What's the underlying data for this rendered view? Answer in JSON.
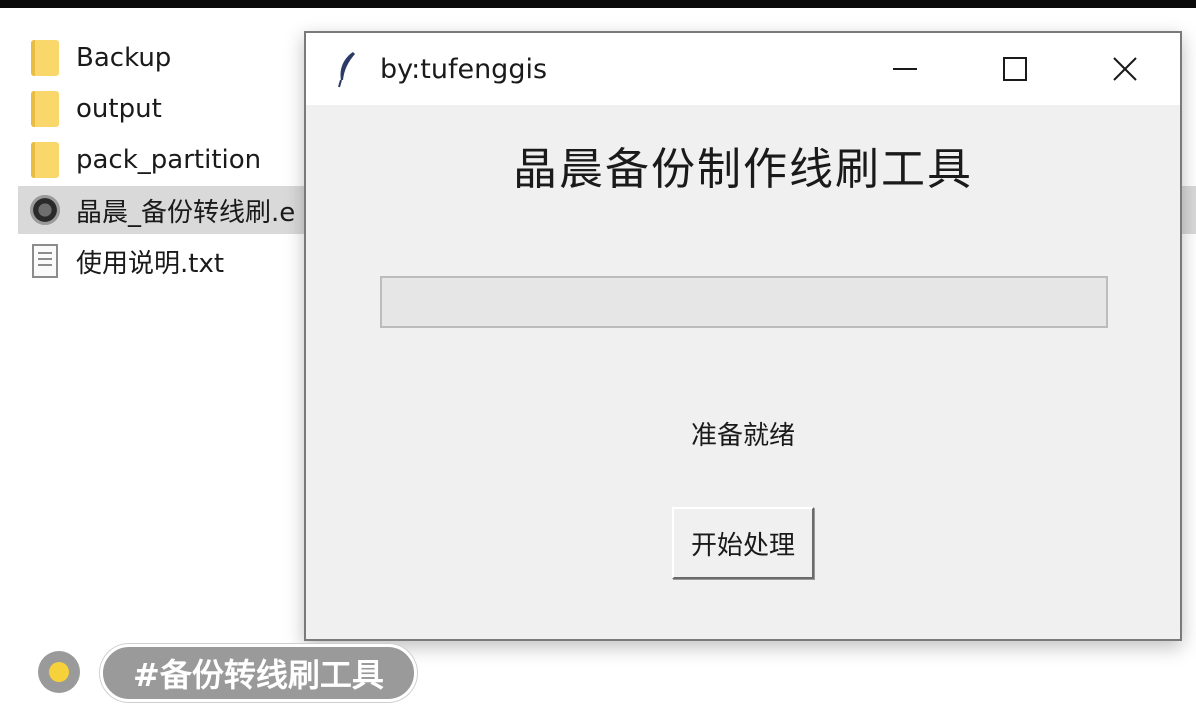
{
  "explorer": {
    "files": [
      {
        "name": "Backup",
        "icon": "folder-icon"
      },
      {
        "name": "output",
        "icon": "folder-icon"
      },
      {
        "name": "pack_partition",
        "icon": "folder-icon"
      },
      {
        "name": "晶晨_备份转线刷.e",
        "icon": "exe-icon",
        "selected": true
      },
      {
        "name": "使用说明.txt",
        "icon": "text-file-icon"
      }
    ]
  },
  "window": {
    "title": "by:tufenggis",
    "icon": "feather-icon",
    "controls": [
      "minimize-icon",
      "maximize-icon",
      "close-icon"
    ],
    "heading": "晶晨备份制作线刷工具",
    "progress": 0,
    "status": "准备就绪",
    "start_button": "开始处理"
  },
  "overlay": {
    "tag": "#备份转线刷工具",
    "dot_color": "#f6d13a"
  }
}
